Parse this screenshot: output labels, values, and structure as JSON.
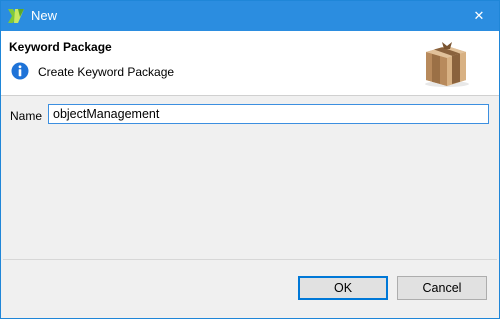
{
  "window": {
    "title": "New",
    "close_symbol": "✕",
    "title_bar_color": "#2b8de0",
    "app_icon": "app-logo-icon"
  },
  "banner": {
    "title": "Keyword Package",
    "message": "Create Keyword Package",
    "info_icon": "info-icon",
    "banner_icon": "package-icon"
  },
  "form": {
    "name_label": "Name",
    "name_value": "objectManagement"
  },
  "buttons": {
    "ok_label": "OK",
    "cancel_label": "Cancel"
  }
}
